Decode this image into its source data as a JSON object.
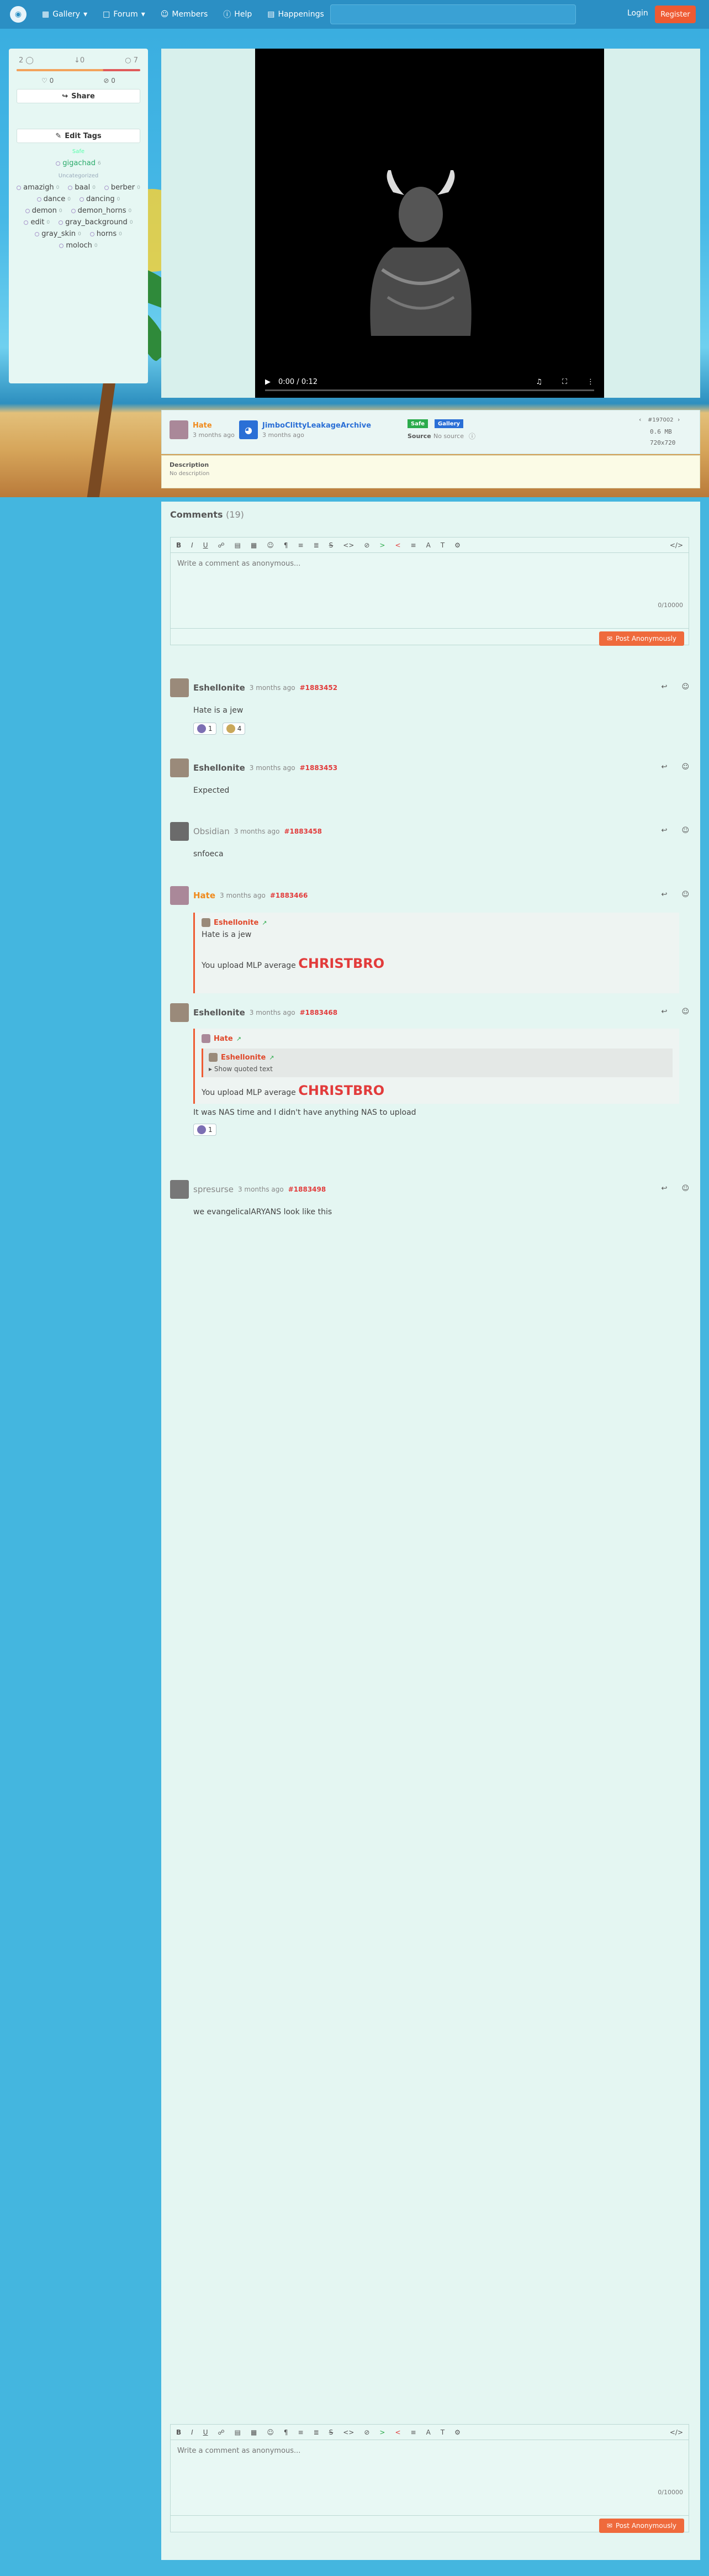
{
  "nav": {
    "items": [
      "Gallery",
      "Forum",
      "Members",
      "Help",
      "Happenings"
    ],
    "login": "Login",
    "register": "Register"
  },
  "sidebar": {
    "score": "2",
    "votes_down": "0",
    "comments_count": "7",
    "score_fraction": 0.7,
    "favs": "0",
    "faves_alt": "0",
    "share": "Share",
    "edit_tags": "Edit Tags",
    "group_safe": "Safe",
    "group_uncat": "Uncategorized",
    "tags": [
      {
        "name": "gigachad",
        "count": "6",
        "green": true
      },
      {
        "name": "amazigh",
        "count": "0",
        "green": false
      },
      {
        "name": "baal",
        "count": "0",
        "green": false
      },
      {
        "name": "berber",
        "count": "0",
        "green": false
      },
      {
        "name": "dance",
        "count": "0",
        "green": false
      },
      {
        "name": "dancing",
        "count": "0",
        "green": false
      },
      {
        "name": "demon",
        "count": "0",
        "green": false
      },
      {
        "name": "demon_horns",
        "count": "0",
        "green": false
      },
      {
        "name": "edit",
        "count": "0",
        "green": false
      },
      {
        "name": "gray_background",
        "count": "0",
        "green": false
      },
      {
        "name": "gray_skin",
        "count": "0",
        "green": false
      },
      {
        "name": "horns",
        "count": "0",
        "green": false
      },
      {
        "name": "moloch",
        "count": "0",
        "green": false
      }
    ]
  },
  "video": {
    "time": "0:00 / 0:12",
    "progress": 0
  },
  "info": {
    "uploader": "Hate",
    "uploader_time": "3 months ago",
    "archive": "JimboClittyLeakageArchive",
    "archive_time": "3 months ago",
    "badge_safe": "Safe",
    "badge_gallery": "Gallery",
    "source_label": "Source",
    "source_value": "No source",
    "image_no": "#197002",
    "size": "0.6 MB",
    "dims": "720x720"
  },
  "description": {
    "title": "Description",
    "text": "No description"
  },
  "comments": {
    "title": "Comments",
    "count": "(19)",
    "placeholder": "Write a comment as anonymous...",
    "counter": "0/10000",
    "post_label": "Post Anonymously",
    "toolbar_src": "</>",
    "items": [
      {
        "author": "Eshellonite",
        "time": "3 months ago",
        "id": "#1883452",
        "body": "Hate is a jew",
        "reactions": [
          "1",
          "4"
        ]
      },
      {
        "author": "Eshellonite",
        "time": "3 months ago",
        "id": "#1883453",
        "body": "Expected"
      },
      {
        "author": "Obsidian",
        "time": "3 months ago",
        "id": "#1883458",
        "body": "snfoeca"
      },
      {
        "author": "Hate",
        "time": "3 months ago",
        "id": "#1883466",
        "quote_author": "Eshellonite",
        "quote_text": "Hate is a jew",
        "body_prefix": "You upload MLP average ",
        "body_big": "CHRISTBRO"
      },
      {
        "author": "Eshellonite",
        "time": "3 months ago",
        "id": "#1883468",
        "quote_author": "Hate",
        "inner_author": "Eshellonite",
        "show_quoted": "Show quoted text",
        "quote_prefix": "You upload MLP average ",
        "quote_big": "CHRISTBRO",
        "body": "It was NAS time and I didn't have anything NAS to upload",
        "reactions": [
          "1"
        ]
      },
      {
        "author": "spresurse",
        "time": "3 months ago",
        "id": "#1883498",
        "body": "we evangelicalARYANS look like this"
      }
    ]
  }
}
